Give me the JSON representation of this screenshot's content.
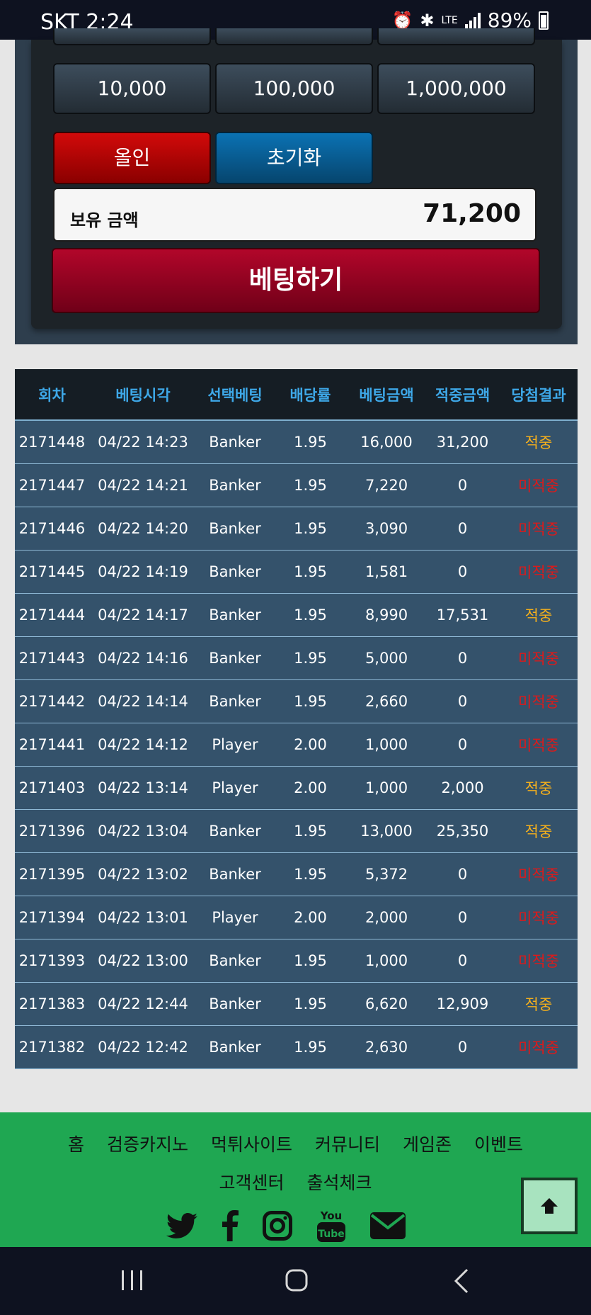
{
  "status_bar": {
    "time": "SKT 2:24",
    "network": "LTE",
    "battery": "89%"
  },
  "betting_panel": {
    "chips": [
      "10,000",
      "100,000",
      "1,000,000"
    ],
    "allin_label": "올인",
    "reset_label": "초기화",
    "balance_label": "보유 금액",
    "balance_value": "71,200",
    "bet_button_label": "베팅하기"
  },
  "history_table": {
    "headers": [
      "회차",
      "베팅시각",
      "선택베팅",
      "배당률",
      "베팅금액",
      "적중금액",
      "당첨결과"
    ],
    "rows": [
      [
        "2171448",
        "04/22 14:23",
        "Banker",
        "1.95",
        "16,000",
        "31,200",
        "적중"
      ],
      [
        "2171447",
        "04/22 14:21",
        "Banker",
        "1.95",
        "7,220",
        "0",
        "미적중"
      ],
      [
        "2171446",
        "04/22 14:20",
        "Banker",
        "1.95",
        "3,090",
        "0",
        "미적중"
      ],
      [
        "2171445",
        "04/22 14:19",
        "Banker",
        "1.95",
        "1,581",
        "0",
        "미적중"
      ],
      [
        "2171444",
        "04/22 14:17",
        "Banker",
        "1.95",
        "8,990",
        "17,531",
        "적중"
      ],
      [
        "2171443",
        "04/22 14:16",
        "Banker",
        "1.95",
        "5,000",
        "0",
        "미적중"
      ],
      [
        "2171442",
        "04/22 14:14",
        "Banker",
        "1.95",
        "2,660",
        "0",
        "미적중"
      ],
      [
        "2171441",
        "04/22 14:12",
        "Player",
        "2.00",
        "1,000",
        "0",
        "미적중"
      ],
      [
        "2171403",
        "04/22 13:14",
        "Player",
        "2.00",
        "1,000",
        "2,000",
        "적중"
      ],
      [
        "2171396",
        "04/22 13:04",
        "Banker",
        "1.95",
        "13,000",
        "25,350",
        "적중"
      ],
      [
        "2171395",
        "04/22 13:02",
        "Banker",
        "1.95",
        "5,372",
        "0",
        "미적중"
      ],
      [
        "2171394",
        "04/22 13:01",
        "Player",
        "2.00",
        "2,000",
        "0",
        "미적중"
      ],
      [
        "2171393",
        "04/22 13:00",
        "Banker",
        "1.95",
        "1,000",
        "0",
        "미적중"
      ],
      [
        "2171383",
        "04/22 12:44",
        "Banker",
        "1.95",
        "6,620",
        "12,909",
        "적중"
      ],
      [
        "2171382",
        "04/22 12:42",
        "Banker",
        "1.95",
        "2,630",
        "0",
        "미적중"
      ]
    ],
    "win_color": "#f5b01c",
    "lose_color": "#dd1a1a"
  },
  "footer": {
    "nav_row1": [
      "홈",
      "검증카지노",
      "먹튀사이트",
      "커뮤니티",
      "게임존",
      "이벤트"
    ],
    "nav_row2": [
      "고객센터",
      "출석체크"
    ],
    "social_icons": [
      "twitter-icon",
      "facebook-icon",
      "instagram-icon",
      "youtube-icon",
      "email-icon"
    ],
    "bg_color": "#1fa752"
  }
}
